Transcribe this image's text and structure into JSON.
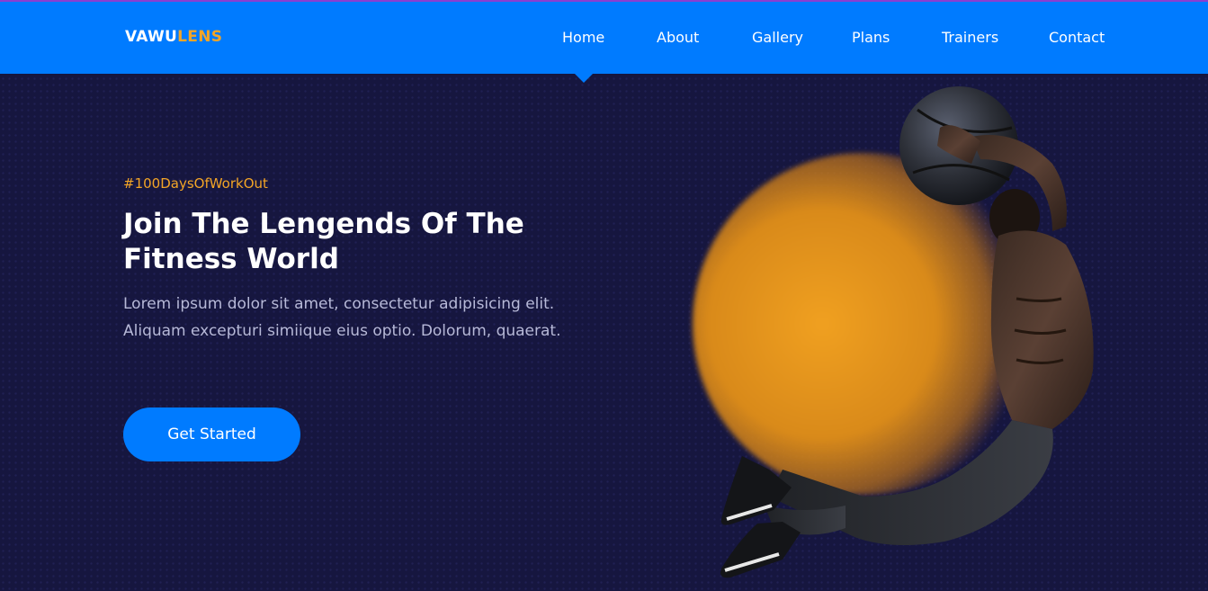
{
  "brand": {
    "name_part1": "VAWU",
    "name_part2": "LENS"
  },
  "nav": {
    "items": [
      {
        "label": "Home",
        "active": true
      },
      {
        "label": "About"
      },
      {
        "label": "Gallery"
      },
      {
        "label": "Plans"
      },
      {
        "label": "Trainers"
      },
      {
        "label": "Contact"
      }
    ]
  },
  "hero": {
    "tagline": "#100DaysOfWorkOut",
    "headline": "Join The Lengends Of The Fitness World",
    "description": "Lorem ipsum dolor sit amet, consectetur adipisicing elit. Aliquam excepturi simiique eius optio. Dolorum, quaerat.",
    "cta_label": "Get Started"
  },
  "colors": {
    "primary": "#007bff",
    "accent": "#f3a526",
    "background": "#16163f",
    "text_muted": "#b7b9d8"
  }
}
